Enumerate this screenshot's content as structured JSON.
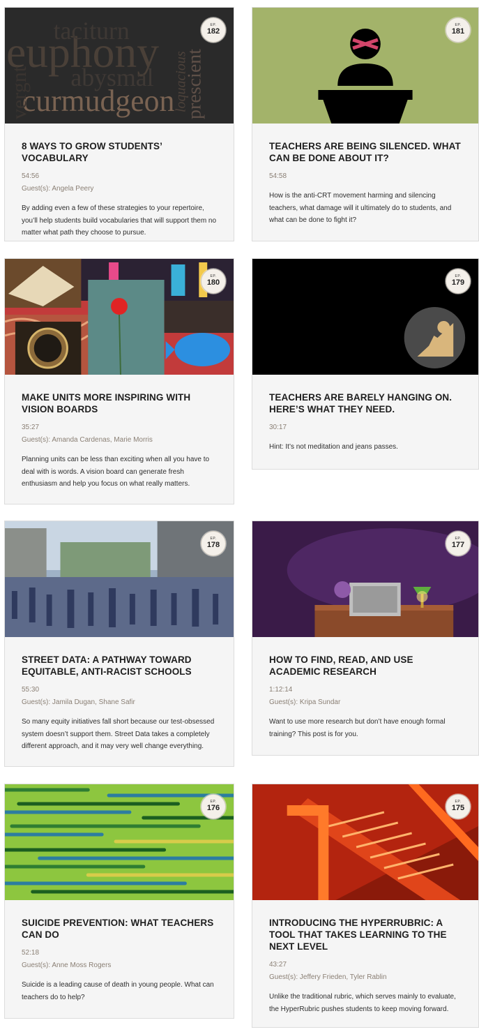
{
  "labels": {
    "ep": "EP.",
    "guests_prefix": "Guest(s): "
  },
  "thumb_text": {
    "ep182_words": [
      "vergnt",
      "taciturn",
      "euphony",
      "abysmal",
      "curmudgeon",
      "prescient",
      "loquacious"
    ]
  },
  "episodes": [
    {
      "number": "182",
      "title": "8 WAYS TO GROW STUDENTS’ VOCABULARY",
      "duration": "54:56",
      "guests": "Angela Peery",
      "description": "By adding even a few of these strategies to your repertoire, you’ll help students build vocabularies that will support them no matter what path they choose to pursue."
    },
    {
      "number": "181",
      "title": "TEACHERS ARE BEING SILENCED. WHAT CAN BE DONE ABOUT IT?",
      "duration": "54:58",
      "guests": "",
      "description": "How is the anti-CRT movement harming and silencing teachers, what damage will it ultimately do to students, and what can be done to fight it?"
    },
    {
      "number": "180",
      "title": "MAKE UNITS MORE INSPIRING WITH VISION BOARDS",
      "duration": "35:27",
      "guests": "Amanda Cardenas, Marie Morris",
      "description": "Planning units can be less than exciting when all you have to deal with is words. A vision board can generate fresh enthusiasm and help you focus on what really matters."
    },
    {
      "number": "179",
      "title": "TEACHERS ARE BARELY HANGING ON. HERE’S WHAT THEY NEED.",
      "duration": "30:17",
      "guests": "",
      "description": "Hint: It’s not meditation and jeans passes."
    },
    {
      "number": "178",
      "title": "STREET DATA: A PATHWAY TOWARD EQUITABLE, ANTI-RACIST SCHOOLS",
      "duration": "55:30",
      "guests": "Jamila Dugan, Shane Safir",
      "description": "So many equity initiatives fall short because our test-obsessed system doesn’t support them. Street Data takes a completely different approach, and it may very well change everything."
    },
    {
      "number": "177",
      "title": "HOW TO FIND, READ, AND USE ACADEMIC RESEARCH",
      "duration": "1:12:14",
      "guests": "Kripa Sundar",
      "description": "Want to use more research but don’t have enough formal training? This post is for you."
    },
    {
      "number": "176",
      "title": "SUICIDE PREVENTION: WHAT TEACHERS CAN DO",
      "duration": "52:18",
      "guests": "Anne Moss Rogers",
      "description": "Suicide is a leading cause of death in young people. What can teachers do to help?"
    },
    {
      "number": "175",
      "title": "INTRODUCING THE HYPERRUBRIC: A TOOL THAT TAKES LEARNING TO THE NEXT LEVEL",
      "duration": "43:27",
      "guests": "Jeffery Frieden, Tyler Rablin",
      "description": "Unlike the traditional rubric, which serves mainly to evaluate, the HyperRubric pushes students to keep moving forward."
    }
  ],
  "colors": {
    "card_bg": "#f5f5f5",
    "meta_text": "#8a7f74",
    "thumb_181_bg": "#a3b36a",
    "thumb_179_bg": "#000000",
    "thumb_176_bg": "#8dc63f"
  }
}
